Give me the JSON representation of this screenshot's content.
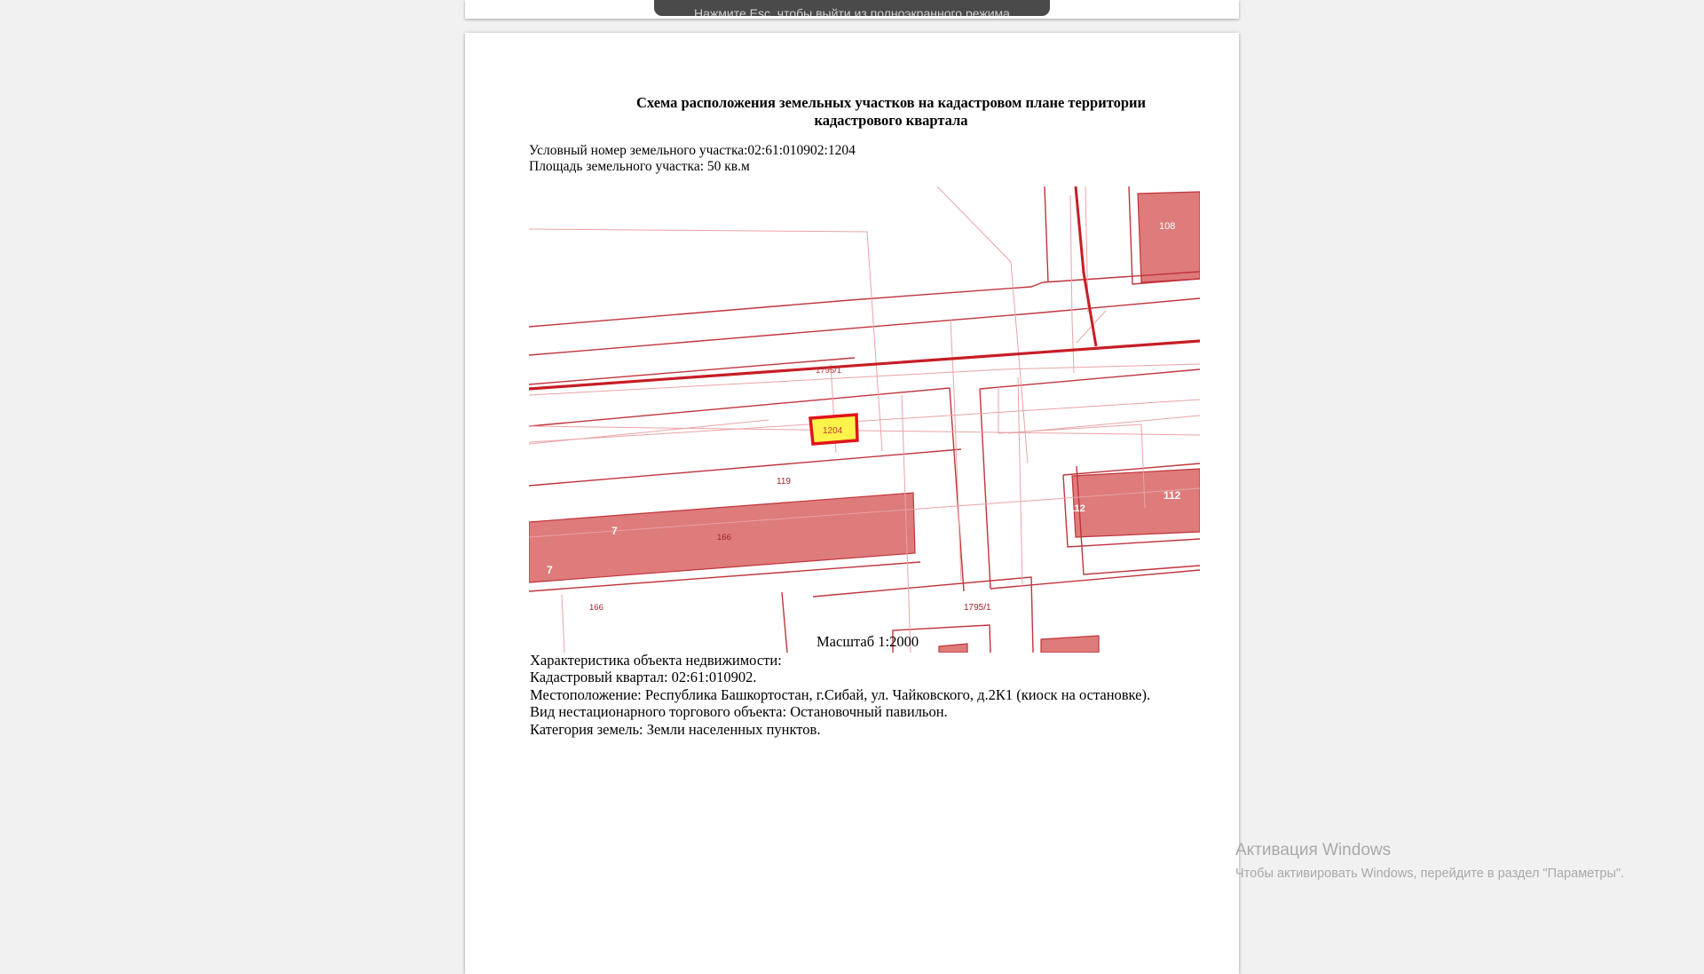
{
  "toast": {
    "text": "Нажмите Esc, чтобы выйти из полноэкранного режима"
  },
  "document": {
    "title_line1": "Схема расположения земельных участков на кадастровом плане территории",
    "title_line2": "кадастрового квартала",
    "parcel_number": "Условный номер земельного участка:02:61:010902:1204",
    "parcel_area": "Площадь земельного участка: 50 кв.м",
    "scale": "Масштаб 1:2000",
    "characteristics": [
      "Характеристика объекта недвижимости:",
      "Кадастровый квартал: 02:61:010902.",
      "Местоположение: Республика Башкортостан, г.Сибай, ул. Чайковского, д.2К1 (киоск на остановке).",
      "Вид нестационарного торгового объекта: Остановочный павильон.",
      "Категория земель: Земли населенных пунктов."
    ]
  },
  "map": {
    "labels": {
      "parcel": "1204",
      "road_top": "1795/1",
      "road_right": "1795/1",
      "lot_119_a": "119",
      "lot_119_b": "119",
      "lot_166_a": "166",
      "lot_166_b": "166",
      "building_7_a": "7",
      "building_7_b": "7",
      "building_108": "108",
      "building_112": "112",
      "building_112_left": "112"
    },
    "colors": {
      "line": "#c0343b",
      "line_light": "#e9a3a6",
      "fill": "#de7b7b",
      "highlight_fill": "#fff24a",
      "highlight_stroke": "#e2141b"
    }
  },
  "taskbar_watermark": {
    "title": "Активация Windows",
    "subtitle": "Чтобы активировать Windows, перейдите в раздел \"Параметры\"."
  }
}
